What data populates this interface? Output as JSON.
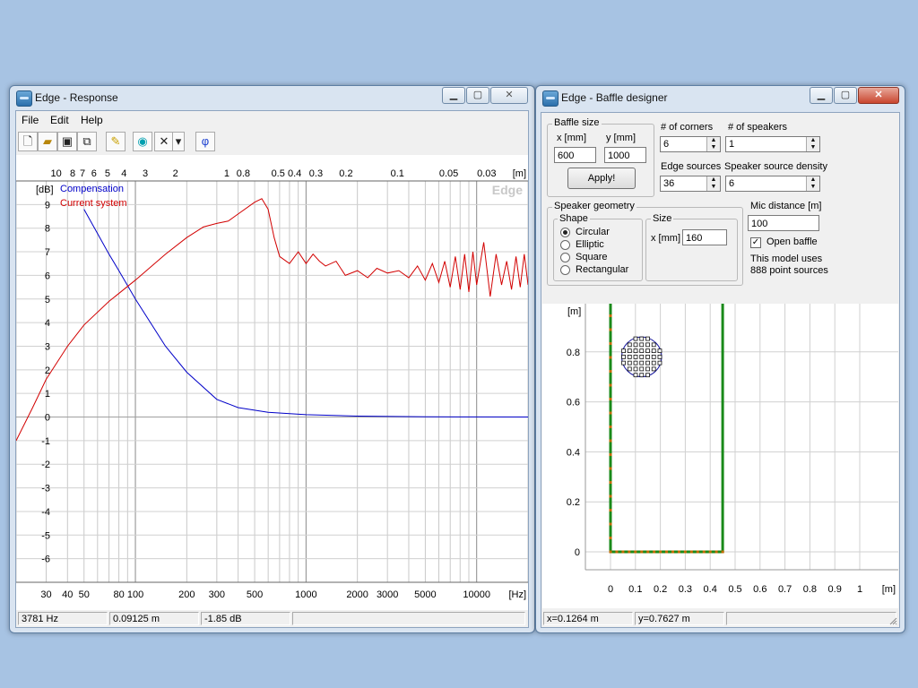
{
  "response_window": {
    "title": "Edge - Response",
    "menu": [
      "File",
      "Edit",
      "Help"
    ],
    "toolbar_icons": [
      "new-file-icon",
      "open-folder-icon",
      "save-icon",
      "copy-icon",
      "pencil-icon",
      "driver-icon",
      "delete-x-icon",
      "dropdown-arrow-icon",
      "phase-icon"
    ],
    "phase_symbol": "φ",
    "delete_symbol": "✕",
    "dropdown_symbol": "▾",
    "watermark": "Edge",
    "status": {
      "frequency": "3781 Hz",
      "distance": "0.09125 m",
      "level": "-1.85 dB"
    }
  },
  "baffle_window": {
    "title": "Edge - Baffle designer",
    "baffle_size": {
      "label": "Baffle size",
      "x_label": "x [mm]",
      "y_label": "y [mm]",
      "x_value": "600",
      "y_value": "1000",
      "apply_label": "Apply!"
    },
    "corners": {
      "label": "# of corners",
      "value": "6"
    },
    "speakers": {
      "label": "# of speakers",
      "value": "1"
    },
    "edge_sources": {
      "label": "Edge sources",
      "value": "36"
    },
    "density": {
      "label": "Speaker source density",
      "value": "6"
    },
    "geometry": {
      "label": "Speaker geometry",
      "shape_label": "Shape",
      "shapes": [
        "Circular",
        "Elliptic",
        "Square",
        "Rectangular"
      ],
      "selected": "Circular",
      "size_label": "Size",
      "size_x_label": "x [mm]",
      "size_value": "160"
    },
    "mic": {
      "label": "Mic distance [m]",
      "value": "100"
    },
    "open_baffle": {
      "label": "Open baffle",
      "checked": true
    },
    "model_info": [
      "This model uses",
      "888 point sources"
    ],
    "status": {
      "x": "x=0.1264 m",
      "y": "y=0.7627 m"
    }
  },
  "chart_data": [
    {
      "type": "line",
      "x_scale": "log",
      "xlabel": "[Hz]",
      "x_top_label": "[m]",
      "ylabel": "[dB]",
      "xlim": [
        20,
        20000
      ],
      "ylim": [
        -7,
        10
      ],
      "x_ticks": [
        30,
        40,
        50,
        80,
        100,
        200,
        300,
        500,
        1000,
        2000,
        3000,
        5000,
        10000
      ],
      "x_tick_labels": [
        "30",
        "40",
        "50",
        "80",
        "100",
        "200",
        "300",
        "500",
        "1000",
        "2000",
        "3000",
        "5000",
        "10000"
      ],
      "top_ticks": [
        10,
        8,
        7,
        6,
        5,
        4,
        3,
        2,
        1,
        0.8,
        0.5,
        0.4,
        0.3,
        0.2,
        0.1,
        0.05,
        0.03
      ],
      "top_tick_labels": [
        "10",
        "8",
        "7",
        "6",
        "5",
        "4",
        "3",
        "2",
        "1",
        "0.8",
        "0.5",
        "0.4",
        "0.3",
        "0.2",
        "0.1",
        "0.05",
        "0.03"
      ],
      "y_ticks": [
        9,
        8,
        7,
        6,
        5,
        4,
        3,
        2,
        1,
        0,
        -1,
        -2,
        -3,
        -4,
        -5,
        -6
      ],
      "grid": true,
      "legend": "top-left",
      "series": [
        {
          "name": "Compensation",
          "color": "#0000c8",
          "x": [
            50,
            70,
            80,
            100,
            150,
            200,
            300,
            400,
            600,
            1000,
            2000,
            5000,
            20000
          ],
          "y": [
            8.8,
            6.9,
            6.2,
            5.0,
            3.0,
            1.9,
            0.75,
            0.4,
            0.2,
            0.1,
            0.04,
            0.01,
            0.0
          ]
        },
        {
          "name": "Current system",
          "color": "#d20000",
          "x": [
            20,
            25,
            30,
            40,
            50,
            70,
            100,
            150,
            200,
            250,
            300,
            350,
            400,
            500,
            550,
            600,
            650,
            700,
            800,
            900,
            1000,
            1100,
            1200,
            1300,
            1500,
            1700,
            2000,
            2300,
            2600,
            3000,
            3500,
            4000,
            4500,
            5000,
            5500,
            6000,
            6500,
            7000,
            7500,
            8000,
            8500,
            9000,
            9500,
            10000,
            11000,
            12000,
            13000,
            14000,
            15000,
            16000,
            17000,
            18000,
            19000,
            20000
          ],
          "y": [
            -1.0,
            0.4,
            1.6,
            3.0,
            3.9,
            4.9,
            5.8,
            6.9,
            7.6,
            8.05,
            8.2,
            8.3,
            8.6,
            9.1,
            9.25,
            8.8,
            7.6,
            6.8,
            6.5,
            7.0,
            6.5,
            6.9,
            6.6,
            6.4,
            6.6,
            6.0,
            6.2,
            5.9,
            6.3,
            6.1,
            6.2,
            5.9,
            6.4,
            5.8,
            6.5,
            5.7,
            6.6,
            5.5,
            6.8,
            5.4,
            6.9,
            5.3,
            7.0,
            5.6,
            7.4,
            5.1,
            6.9,
            5.6,
            6.6,
            5.4,
            6.8,
            5.5,
            6.9,
            5.6
          ]
        }
      ]
    },
    {
      "type": "scatter",
      "title": "",
      "ylabel": "[m]",
      "xlabel": "[m]",
      "xlim": [
        -0.1,
        1.15
      ],
      "ylim": [
        -0.1,
        1.0
      ],
      "x_ticks": [
        0,
        0.1,
        0.2,
        0.3,
        0.4,
        0.5,
        0.6,
        0.7,
        0.8,
        0.9,
        1
      ],
      "y_ticks": [
        0,
        0.2,
        0.4,
        0.6,
        0.8
      ],
      "grid": true,
      "baffle_outline": {
        "x": [
          0,
          0.45,
          0.45,
          0,
          0
        ],
        "y": [
          0,
          0,
          1.0,
          1.0,
          0
        ],
        "color": "#1a8a1a"
      },
      "speaker": {
        "center_x": 0.125,
        "center_y": 0.78,
        "radius": 0.08
      }
    }
  ]
}
